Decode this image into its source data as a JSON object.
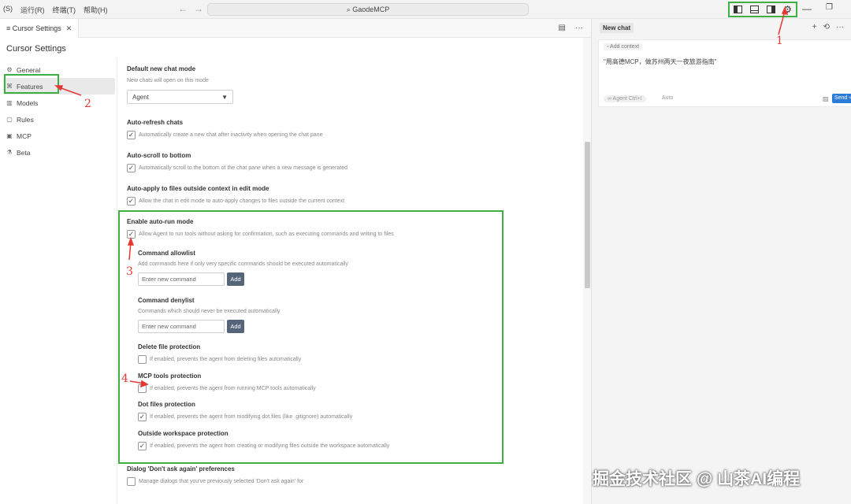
{
  "titlebar": {
    "menu": [
      "(S)",
      "运行(R)",
      "终端(T)",
      "帮助(H)"
    ],
    "nav_back": "←",
    "nav_forward": "→",
    "command_center": "⌕ GaodeMCP",
    "gear": "⚙",
    "minimize": "—",
    "restore": "❐"
  },
  "tabbar": {
    "tab_label": "≡ Cursor Settings",
    "tab_close": "✕",
    "icon_split": "▤",
    "icon_more": "···"
  },
  "settings": {
    "title": "Cursor Settings",
    "nav": [
      {
        "icon": "⚙",
        "label": "General"
      },
      {
        "icon": "⌘",
        "label": "Features"
      },
      {
        "icon": "▥",
        "label": "Models"
      },
      {
        "icon": "▢",
        "label": "Rules"
      },
      {
        "icon": "▣",
        "label": "MCP"
      },
      {
        "icon": "⚗",
        "label": "Beta"
      }
    ],
    "default_chat": {
      "title": "Default new chat mode",
      "desc": "New chats will open on this mode",
      "value": "Agent",
      "arrow": "▼"
    },
    "auto_refresh": {
      "title": "Auto-refresh chats",
      "desc": "Automatically create a new chat after inactivity when opening the chat pane",
      "checked": "✓"
    },
    "auto_scroll": {
      "title": "Auto-scroll to bottom",
      "desc": "Automatically scroll to the bottom of the chat pane when a new message is generated",
      "checked": "✓"
    },
    "auto_apply": {
      "title": "Auto-apply to files outside context in edit mode",
      "desc": "Allow the chat in edit mode to auto-apply changes to files outside the current context",
      "checked": "✓"
    },
    "auto_run": {
      "title": "Enable auto-run mode",
      "desc": "Allow Agent to run tools without asking for confirmation, such as executing commands and writing to files",
      "checked": "✓"
    },
    "allowlist": {
      "title": "Command allowlist",
      "desc": "Add commands here if only very specific commands should be executed automatically",
      "placeholder": "Enter new command",
      "add": "Add"
    },
    "denylist": {
      "title": "Command denylist",
      "desc": "Commands which should never be executed automatically",
      "placeholder": "Enter new command",
      "add": "Add"
    },
    "delete_protection": {
      "title": "Delete file protection",
      "desc": "If enabled, prevents the agent from deleting files automatically",
      "checked": ""
    },
    "mcp_protection": {
      "title": "MCP tools protection",
      "desc": "If enabled, prevents the agent from running MCP tools automatically",
      "checked": ""
    },
    "dotfiles_protection": {
      "title": "Dot files protection",
      "desc": "If enabled, prevents the agent from modifying dot files (like .gitignore) automatically",
      "checked": "✓"
    },
    "workspace_protection": {
      "title": "Outside workspace protection",
      "desc": "If enabled, prevents the agent from creating or modifying files outside the workspace automatically",
      "checked": "✓"
    },
    "dont_ask": {
      "title": "Dialog 'Don't ask again' preferences",
      "desc": "Manage dialogs that you've previously selected 'Don't ask again' for",
      "checked": ""
    }
  },
  "chat": {
    "tab_label": "New chat",
    "icon_add": "+",
    "icon_history": "⟲",
    "icon_more": "···",
    "add_context": "▫ Add context",
    "message": "\"用高德MCP，做苏州两天一夜旅游指南\"",
    "agent": "∞ Agent Ctrl+I",
    "auto": "Auto",
    "image_icon": "▨",
    "send": "Send ⏎"
  },
  "annotations": [
    "1",
    "2",
    "3",
    "4"
  ],
  "watermark": "掘金技术社区 @ 山茶AI编程",
  "colors": {
    "highlight_box": "#3cb043",
    "annotation": "#e53935",
    "send_button": "#2b7bd6",
    "add_button": "#56647a"
  }
}
